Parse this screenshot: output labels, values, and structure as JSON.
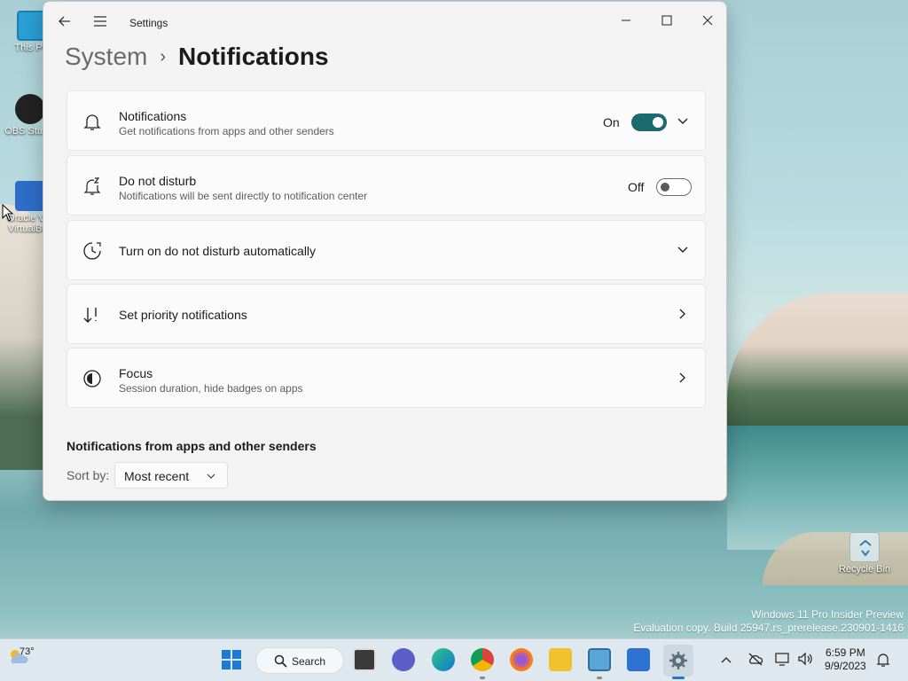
{
  "desktop": {
    "icons": [
      {
        "label": "This PC"
      },
      {
        "label": "OBS Studio"
      },
      {
        "label": "Oracle VM VirtualBox"
      },
      {
        "label": "Recycle Bin"
      }
    ],
    "watermark": {
      "line1": "Windows 11 Pro Insider Preview",
      "line2": "Evaluation copy. Build 25947.rs_prerelease.230901-1416"
    }
  },
  "window": {
    "app_title": "Settings",
    "breadcrumb": {
      "parent": "System",
      "current": "Notifications"
    },
    "cards": [
      {
        "title": "Notifications",
        "subtitle": "Get notifications from apps and other senders",
        "state": "On"
      },
      {
        "title": "Do not disturb",
        "subtitle": "Notifications will be sent directly to notification center",
        "state": "Off"
      },
      {
        "title": "Turn on do not disturb automatically"
      },
      {
        "title": "Set priority notifications"
      },
      {
        "title": "Focus",
        "subtitle": "Session duration, hide badges on apps"
      }
    ],
    "section_heading": "Notifications from apps and other senders",
    "sort": {
      "label": "Sort by:",
      "value": "Most recent"
    }
  },
  "taskbar": {
    "weather_temp": "73°",
    "search_label": "Search",
    "time": "6:59 PM",
    "date": "9/9/2023"
  },
  "colors": {
    "accent": "#1b6a70",
    "window_bg": "#f3f3f3",
    "card_bg": "#fbfbfb"
  }
}
